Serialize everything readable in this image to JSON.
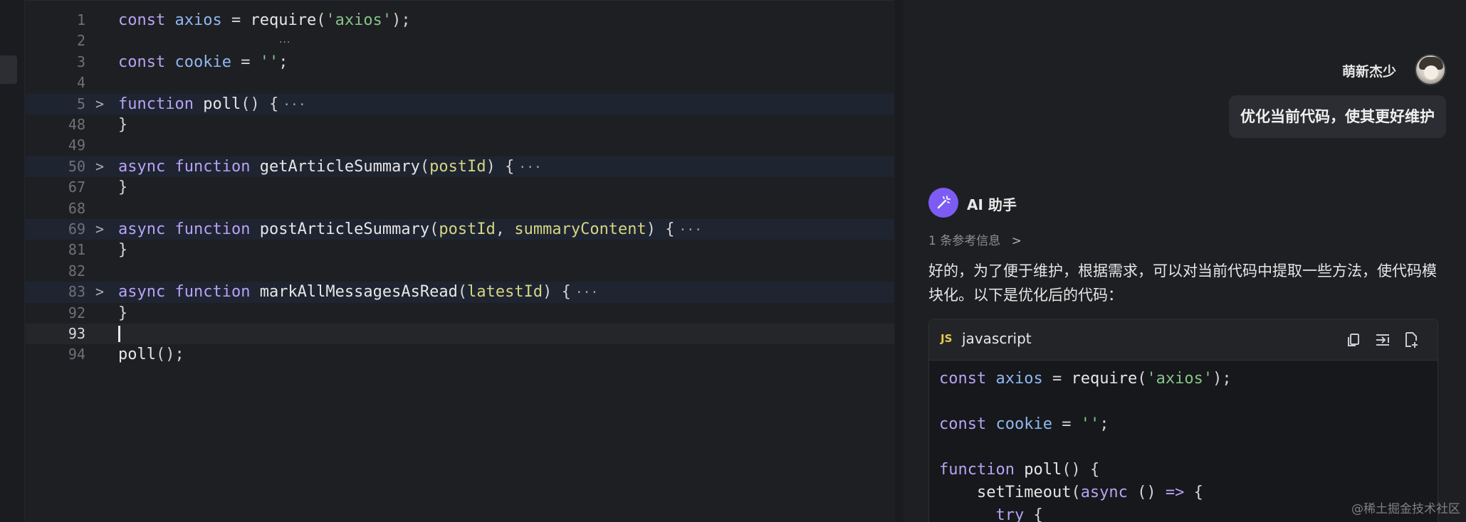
{
  "editor": {
    "lines": [
      {
        "no": "1",
        "tokens": [
          {
            "c": "kw",
            "t": "const"
          },
          {
            "c": "",
            "t": " "
          },
          {
            "c": "var",
            "t": "axios"
          },
          {
            "c": "",
            "t": " = "
          },
          {
            "c": "fn",
            "t": "require"
          },
          {
            "c": "",
            "t": "("
          },
          {
            "c": "str",
            "t": "'axios'"
          },
          {
            "c": "",
            "t": ");"
          }
        ]
      },
      {
        "no": "2",
        "tokens": []
      },
      {
        "no": "3",
        "tokens": [
          {
            "c": "kw",
            "t": "const"
          },
          {
            "c": "",
            "t": " "
          },
          {
            "c": "var",
            "t": "cookie"
          },
          {
            "c": "",
            "t": " = "
          },
          {
            "c": "str",
            "t": "''"
          },
          {
            "c": "",
            "t": ";"
          }
        ]
      },
      {
        "no": "4",
        "tokens": []
      },
      {
        "no": "5",
        "folded": true,
        "tokens": [
          {
            "c": "kw",
            "t": "function"
          },
          {
            "c": "",
            "t": " "
          },
          {
            "c": "fn",
            "t": "poll"
          },
          {
            "c": "",
            "t": "() {"
          }
        ]
      },
      {
        "no": "48",
        "tokens": [
          {
            "c": "",
            "t": "}"
          }
        ]
      },
      {
        "no": "49",
        "tokens": []
      },
      {
        "no": "50",
        "folded": true,
        "tokens": [
          {
            "c": "kw",
            "t": "async"
          },
          {
            "c": "",
            "t": " "
          },
          {
            "c": "kw",
            "t": "function"
          },
          {
            "c": "",
            "t": " "
          },
          {
            "c": "fn",
            "t": "getArticleSummary"
          },
          {
            "c": "",
            "t": "("
          },
          {
            "c": "param",
            "t": "postId"
          },
          {
            "c": "",
            "t": ") {"
          }
        ]
      },
      {
        "no": "67",
        "tokens": [
          {
            "c": "",
            "t": "}"
          }
        ]
      },
      {
        "no": "68",
        "tokens": []
      },
      {
        "no": "69",
        "folded": true,
        "tokens": [
          {
            "c": "kw",
            "t": "async"
          },
          {
            "c": "",
            "t": " "
          },
          {
            "c": "kw",
            "t": "function"
          },
          {
            "c": "",
            "t": " "
          },
          {
            "c": "fn",
            "t": "postArticleSummary"
          },
          {
            "c": "",
            "t": "("
          },
          {
            "c": "param",
            "t": "postId"
          },
          {
            "c": "",
            "t": ", "
          },
          {
            "c": "param",
            "t": "summaryContent"
          },
          {
            "c": "",
            "t": ") {"
          }
        ]
      },
      {
        "no": "81",
        "tokens": [
          {
            "c": "",
            "t": "}"
          }
        ]
      },
      {
        "no": "82",
        "tokens": []
      },
      {
        "no": "83",
        "folded": true,
        "tokens": [
          {
            "c": "kw",
            "t": "async"
          },
          {
            "c": "",
            "t": " "
          },
          {
            "c": "kw",
            "t": "function"
          },
          {
            "c": "",
            "t": " "
          },
          {
            "c": "fn",
            "t": "markAllMessagesAsRead"
          },
          {
            "c": "",
            "t": "("
          },
          {
            "c": "param",
            "t": "latestId"
          },
          {
            "c": "",
            "t": ") {"
          }
        ]
      },
      {
        "no": "92",
        "tokens": [
          {
            "c": "",
            "t": "}"
          }
        ]
      },
      {
        "no": "93",
        "cursor": true,
        "tokens": []
      },
      {
        "no": "94",
        "tokens": [
          {
            "c": "fn",
            "t": "poll"
          },
          {
            "c": "",
            "t": "();"
          }
        ]
      }
    ],
    "fold_marker": "···",
    "fold_chevron": ">",
    "hint_marker": "···"
  },
  "chat": {
    "user": {
      "name": "萌新杰少",
      "message": "优化当前代码，使其更好维护"
    },
    "assistant": {
      "name": "AI 助手",
      "refs": "1 条参考信息",
      "ref_chevron": ">",
      "text": "好的，为了便于维护，根据需求，可以对当前代码中提取一些方法，使代码模块化。以下是优化后的代码：",
      "code_block": {
        "lang_icon": "JS",
        "lang": "javascript",
        "buttons": [
          "copy-icon",
          "insert-icon",
          "new-file-icon"
        ],
        "lines": [
          [
            {
              "c": "kw",
              "t": "const"
            },
            {
              "c": "",
              "t": " "
            },
            {
              "c": "var",
              "t": "axios"
            },
            {
              "c": "",
              "t": " = "
            },
            {
              "c": "fn",
              "t": "require"
            },
            {
              "c": "",
              "t": "("
            },
            {
              "c": "str",
              "t": "'axios'"
            },
            {
              "c": "",
              "t": ");"
            }
          ],
          [],
          [
            {
              "c": "kw",
              "t": "const"
            },
            {
              "c": "",
              "t": " "
            },
            {
              "c": "var",
              "t": "cookie"
            },
            {
              "c": "",
              "t": " = "
            },
            {
              "c": "str",
              "t": "''"
            },
            {
              "c": "",
              "t": ";"
            }
          ],
          [],
          [
            {
              "c": "kw",
              "t": "function"
            },
            {
              "c": "",
              "t": " "
            },
            {
              "c": "fn",
              "t": "poll"
            },
            {
              "c": "",
              "t": "() {"
            }
          ],
          [
            {
              "c": "",
              "t": "    "
            },
            {
              "c": "fn",
              "t": "setTimeout"
            },
            {
              "c": "",
              "t": "("
            },
            {
              "c": "kw",
              "t": "async"
            },
            {
              "c": "",
              "t": " () "
            },
            {
              "c": "kw",
              "t": "=>"
            },
            {
              "c": "",
              "t": " {"
            }
          ],
          [
            {
              "c": "",
              "t": "      "
            },
            {
              "c": "kw",
              "t": "try"
            },
            {
              "c": "",
              "t": " {"
            }
          ]
        ]
      }
    },
    "watermark": "@稀土掘金技术社区"
  },
  "colors": {
    "background": "#1e1f22",
    "keyword": "#b7a3f5",
    "variable": "#8fb8f2",
    "string": "#87c38a",
    "param": "#d5d582",
    "ai_accent": "#7c5cf5",
    "js_badge": "#e7c94a"
  }
}
